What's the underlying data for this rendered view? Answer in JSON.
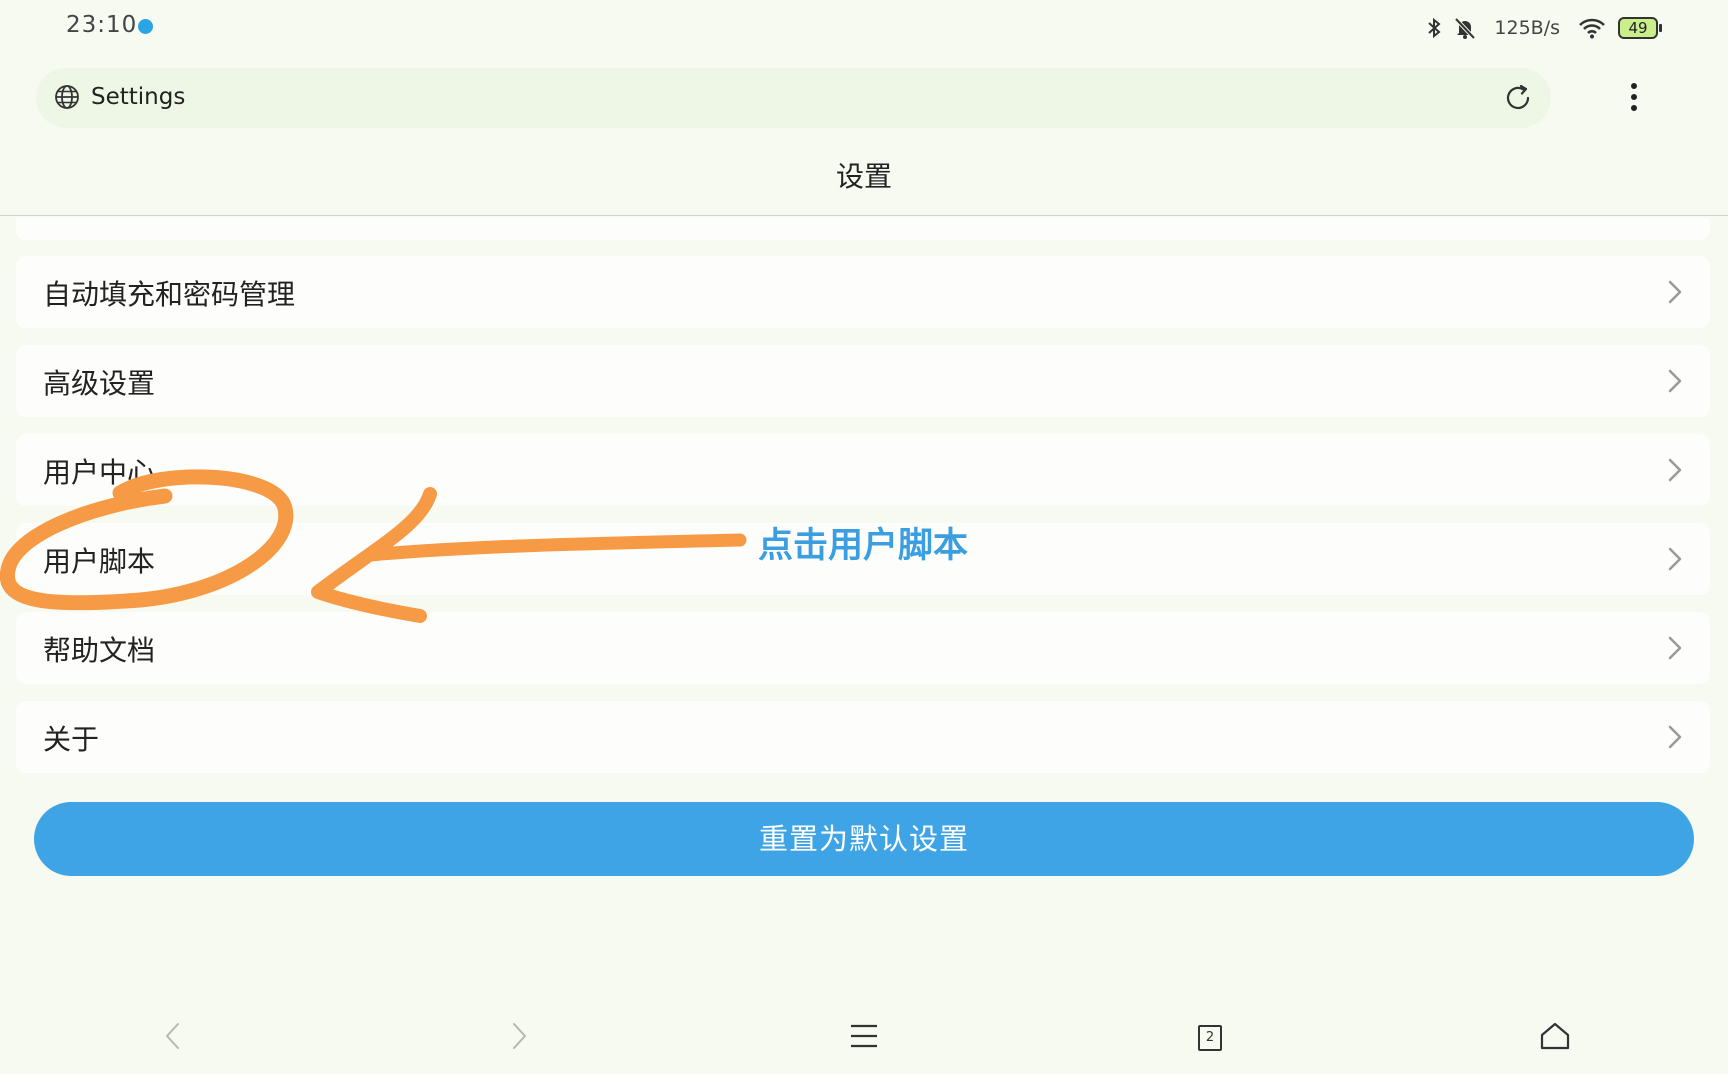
{
  "status_bar": {
    "time": "23:10",
    "net_speed": "125B/s",
    "battery": "49"
  },
  "address_bar": {
    "text": "Settings"
  },
  "page": {
    "title": "设置"
  },
  "settings": {
    "items": [
      {
        "label": "自动填充和密码管理"
      },
      {
        "label": "高级设置"
      },
      {
        "label": "用户中心"
      },
      {
        "label": "用户脚本"
      },
      {
        "label": "帮助文档"
      },
      {
        "label": "关于"
      }
    ],
    "reset_label": "重置为默认设置"
  },
  "annotation": {
    "text": "点击用户脚本",
    "arrow_color": "#f79a45",
    "text_color": "#3a9ee0"
  },
  "bottom_nav": {
    "tab_count": "2"
  },
  "colors": {
    "background": "#f6faf1",
    "accent": "#3ea4e6",
    "address_bar": "#eef7e6"
  }
}
